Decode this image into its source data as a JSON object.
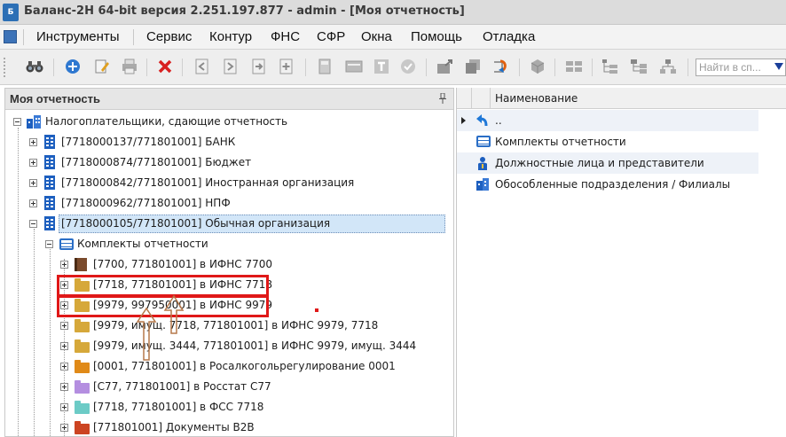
{
  "window": {
    "title": "Баланс-2Н 64-bit версия 2.251.197.877 - admin - [Моя отчетность]",
    "logo_text": "Б"
  },
  "menu": {
    "items": [
      "Инструменты",
      "Сервис",
      "Контур",
      "ФНС",
      "СФР",
      "Окна",
      "Помощь",
      "Отладка"
    ]
  },
  "toolbar": {
    "search_placeholder": "Найти в сп...",
    "buttons": [
      "binoculars-icon",
      "add-icon",
      "edit-icon",
      "print-icon",
      "delete-icon",
      "move-left-icon",
      "move-right-icon",
      "export-icon",
      "add-doc-icon",
      "calculator-icon",
      "table-icon",
      "text-icon",
      "check-icon",
      "upload-icon",
      "copy-icon",
      "refresh-icon",
      "package-icon",
      "grid-icon",
      "tree-icon",
      "hierarchy-icon",
      "org-chart-icon"
    ]
  },
  "left_panel": {
    "title": "Моя отчетность",
    "tree": {
      "root": "Налогоплательщики, сдающие отчетность",
      "orgs": [
        "[7718000137/771801001] БАНК",
        "[7718000874/771801001] Бюджет",
        "[7718000842/771801001] Иностранная организация",
        "[7718000962/771801001] НПФ",
        "[7718000105/771801001] Обычная организация"
      ],
      "kits_node": "Комплекты отчетности",
      "kits": [
        "[7700, 771801001] в ИФНС 7700",
        "[7718, 771801001] в ИФНС 7718",
        "[9979, 997950001] в ИФНС 9979",
        "[9979, имущ. 7718, 771801001] в ИФНС 9979, 7718",
        "[9979, имущ. 3444, 771801001] в ИФНС 9979, имущ. 3444",
        "[0001, 771801001] в Росалкогольрегулирование 0001",
        "[С77, 771801001] в Росстат С77",
        "[7718, 771801001] в ФСС 7718",
        "[771801001] Документы В2В"
      ]
    }
  },
  "right_panel": {
    "column_header": "Наименование",
    "rows": [
      "..",
      "Комплекты отчетности",
      "Должностные лица и представители",
      "Обособленные подразделения / Филиалы"
    ]
  },
  "colors": {
    "highlight_red": "#e01818",
    "annotation_arrow": "#b5784a",
    "folder_yellow": "#d6a83a",
    "folder_orange": "#e08a18",
    "folder_purple": "#b48ee0",
    "folder_teal": "#6ccbc6",
    "folder_red": "#cc4422",
    "selection_bg": "#d2e6f8"
  }
}
